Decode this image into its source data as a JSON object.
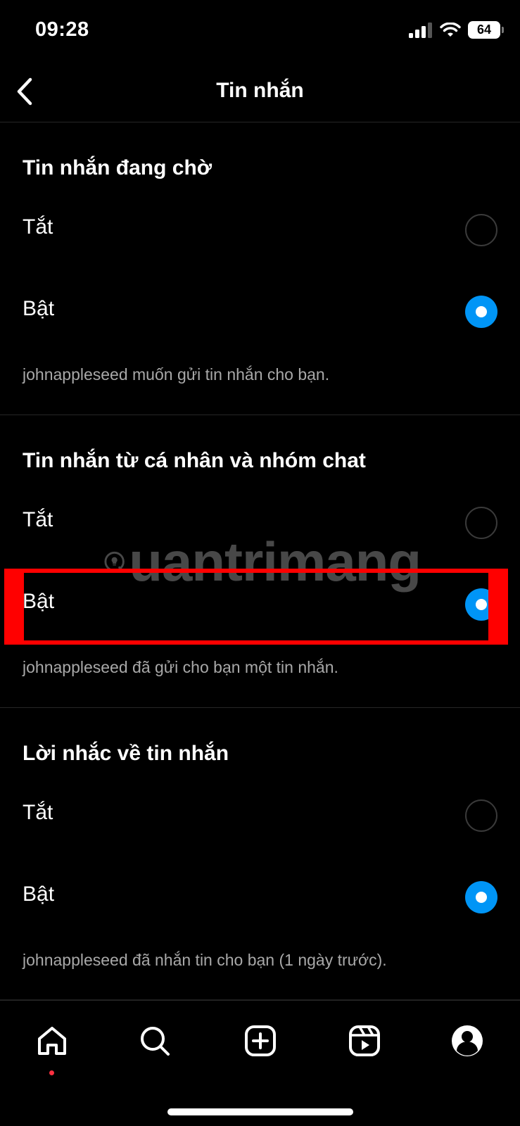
{
  "status_bar": {
    "time": "09:28",
    "battery": "64"
  },
  "header": {
    "title": "Tin nhắn"
  },
  "sections": [
    {
      "title": "Tin nhắn đang chờ",
      "options": [
        {
          "label": "Tắt",
          "selected": false
        },
        {
          "label": "Bật",
          "selected": true
        }
      ],
      "description": "johnappleseed muốn gửi tin nhắn cho bạn."
    },
    {
      "title": "Tin nhắn từ cá nhân và nhóm chat",
      "options": [
        {
          "label": "Tắt",
          "selected": false
        },
        {
          "label": "Bật",
          "selected": true
        }
      ],
      "description": "johnappleseed đã gửi cho bạn một tin nhắn."
    },
    {
      "title": "Lời nhắc về tin nhắn",
      "options": [
        {
          "label": "Tắt",
          "selected": false
        },
        {
          "label": "Bật",
          "selected": true
        }
      ],
      "description": "johnappleseed đã nhắn tin cho bạn (1 ngày trước)."
    }
  ],
  "watermark": {
    "text": "uantrimang"
  },
  "tab_bar": {
    "tabs": [
      "home-icon",
      "search-icon",
      "create-icon",
      "reels-icon",
      "profile-icon"
    ],
    "active": "home-icon"
  },
  "colors": {
    "accent": "#0095f6",
    "highlight": "#ff0000",
    "notification_dot": "#ff3040"
  }
}
